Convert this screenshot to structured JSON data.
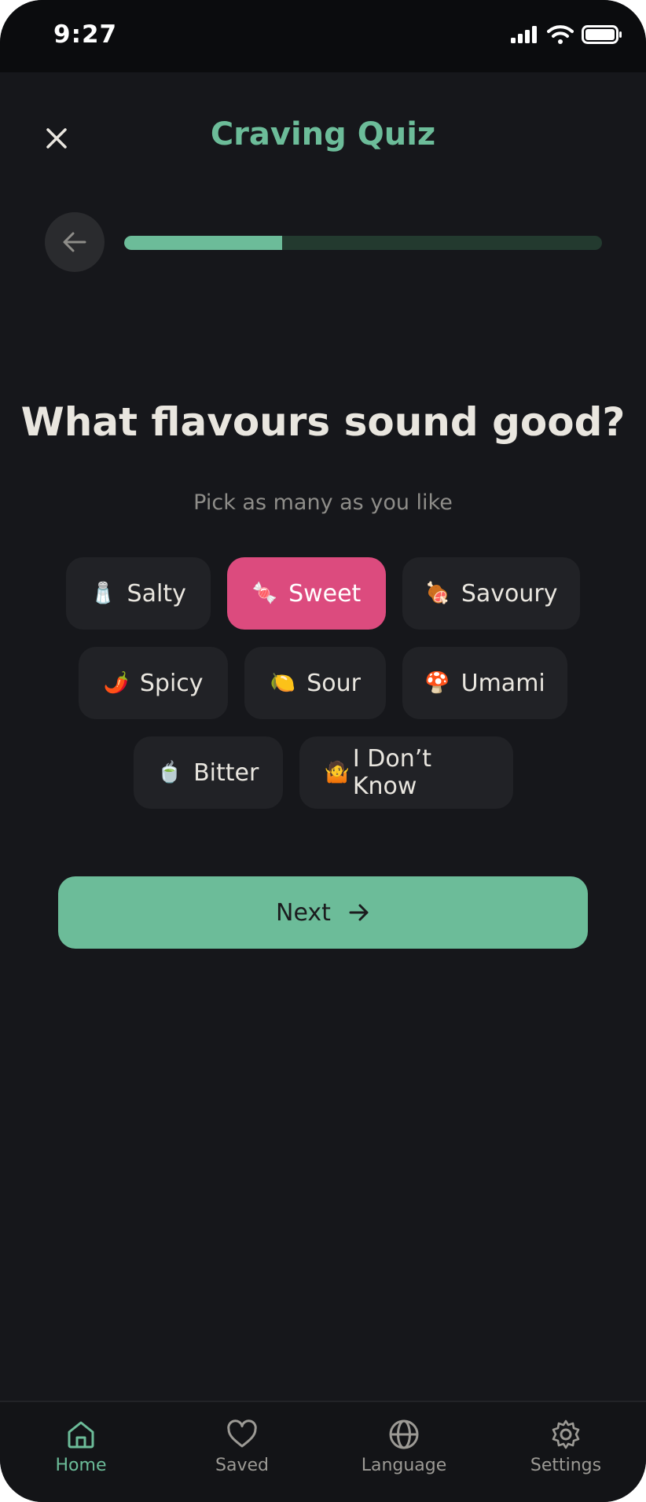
{
  "status_bar": {
    "time": "9:27"
  },
  "header": {
    "title": "Craving Quiz"
  },
  "progress": {
    "fraction": 0.33
  },
  "question": {
    "title": "What flavours sound good?",
    "subtitle": "Pick as many as you like"
  },
  "options": [
    {
      "label": "Salty",
      "emoji": "🧂",
      "selected": false
    },
    {
      "label": "Sweet",
      "emoji": "🍬",
      "selected": true
    },
    {
      "label": "Savoury",
      "emoji": "🍖",
      "selected": false
    },
    {
      "label": "Spicy",
      "emoji": "🌶️",
      "selected": false
    },
    {
      "label": "Sour",
      "emoji": "🍋",
      "selected": false
    },
    {
      "label": "Umami",
      "emoji": "🍄",
      "selected": false
    },
    {
      "label": "Bitter",
      "emoji": "🍵",
      "selected": false
    },
    {
      "label": "I Don’t Know",
      "emoji": "🤷",
      "selected": false
    }
  ],
  "next_button": {
    "label": "Next"
  },
  "bottom_nav": {
    "items": [
      {
        "label": "Home",
        "icon": "home-icon",
        "active": true
      },
      {
        "label": "Saved",
        "icon": "heart-icon",
        "active": false
      },
      {
        "label": "Language",
        "icon": "globe-icon",
        "active": false
      },
      {
        "label": "Settings",
        "icon": "gear-icon",
        "active": false
      }
    ]
  },
  "colors": {
    "accent": "#6cbc99",
    "selected_chip": "#dc4b7e",
    "background": "#16171b",
    "chip": "#212226"
  }
}
